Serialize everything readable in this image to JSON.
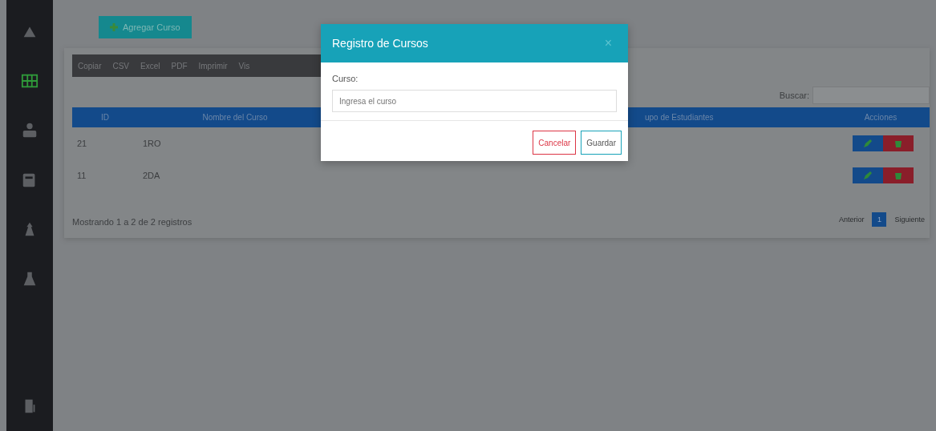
{
  "sidebar": {
    "items": [
      {
        "kind": "logo",
        "selected": false
      },
      {
        "kind": "grid",
        "selected": true
      },
      {
        "kind": "users",
        "selected": false
      },
      {
        "kind": "card",
        "selected": false
      },
      {
        "kind": "tower",
        "selected": false
      },
      {
        "kind": "flask",
        "selected": false
      },
      {
        "kind": "door",
        "selected": false
      }
    ]
  },
  "add_button": "Agregar Curso",
  "export_buttons": [
    "Copiar",
    "CSV",
    "Excel",
    "PDF",
    "Imprimir",
    "Vis"
  ],
  "search": {
    "label": "Buscar:"
  },
  "table": {
    "columns": [
      "ID",
      "Nombre del Curso",
      "upo de Estudiantes",
      "Acciones"
    ],
    "rows": [
      {
        "cells": [
          "21",
          "1RO"
        ]
      },
      {
        "cells": [
          "11",
          "2DA"
        ]
      }
    ]
  },
  "info": "Mostrando 1 a 2 de 2 registros",
  "pagination": [
    {
      "label": "Anterior",
      "selected": false
    },
    {
      "label": "1",
      "selected": true
    },
    {
      "label": "Siguiente",
      "selected": false
    }
  ],
  "modal": {
    "title": "Registro de Cursos",
    "close": "×",
    "field_label": "Curso:",
    "placeholder": "Ingresa el curso",
    "buttons": [
      {
        "label": "Cancelar",
        "kind": "cancel"
      },
      {
        "label": "Guardar",
        "kind": "save"
      }
    ]
  }
}
